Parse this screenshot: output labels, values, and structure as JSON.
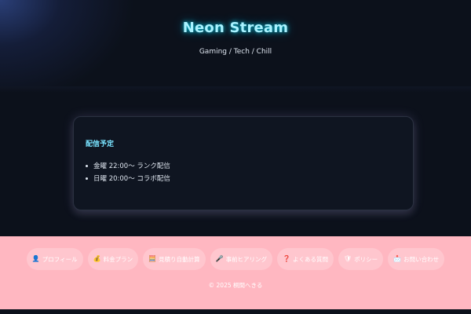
{
  "header": {
    "title": "Neon Stream",
    "tagline": "Gaming / Tech / Chill"
  },
  "schedule": {
    "title": "配信予定",
    "items": [
      {
        "text": "金曜 22:00〜 ランク配信"
      },
      {
        "text": "日曜 20:00〜 コラボ配信"
      }
    ]
  },
  "footer": {
    "nav": [
      {
        "icon": "person-icon",
        "glyph": "👤",
        "label": "プロフィール"
      },
      {
        "icon": "money-bag-icon",
        "glyph": "💰",
        "label": "料金プラン"
      },
      {
        "icon": "calculator-icon",
        "glyph": "🧮",
        "label": "見積り自動計算"
      },
      {
        "icon": "microphone-icon",
        "glyph": "🎤",
        "label": "事前ヒアリング"
      },
      {
        "icon": "question-icon",
        "glyph": "❓",
        "label": "よくある質問"
      },
      {
        "icon": "shield-icon",
        "glyph": "🛡",
        "label": "ポリシー"
      },
      {
        "icon": "mail-icon",
        "glyph": "📩",
        "label": "お問い合わせ"
      }
    ],
    "copyright": "© 2025 桐間へきる"
  },
  "colors": {
    "background": "#0c111b",
    "title_glow": "#00e5ff",
    "card_title": "#79e3ff",
    "footer_bg": "#ffb7c1"
  }
}
